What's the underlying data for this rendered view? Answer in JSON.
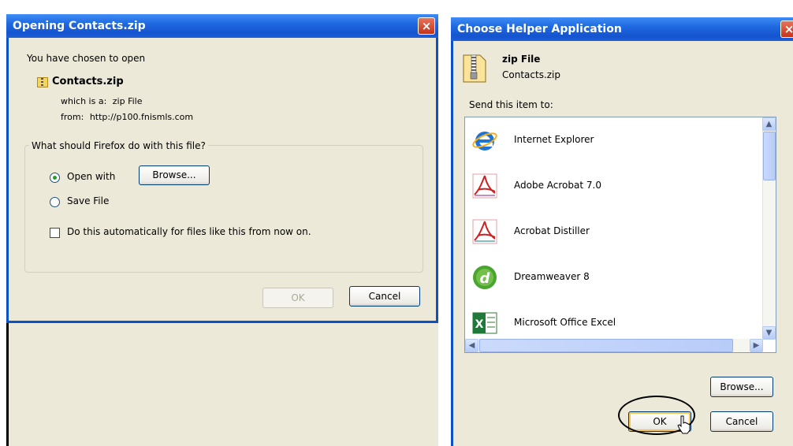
{
  "left_dialog": {
    "title": "Opening Contacts.zip",
    "close_glyph": "×",
    "intro": "You have chosen to open",
    "file_name": "Contacts.zip",
    "which_is_label": "which is a:",
    "which_is_value": "zip File",
    "from_label": "from:",
    "from_value": "http://p100.fnismls.com",
    "group_label": "What should Firefox do with this file?",
    "open_with_label": "Open with",
    "open_with_selected": true,
    "browse_label": "Browse...",
    "save_file_label": "Save File",
    "save_file_selected": false,
    "auto_label": "Do this automatically for files like this from now on.",
    "auto_checked": false,
    "ok_label": "OK",
    "cancel_label": "Cancel"
  },
  "right_dialog": {
    "title": "Choose Helper Application",
    "close_glyph": "×",
    "file_type": "zip File",
    "file_name": "Contacts.zip",
    "send_to_label": "Send this item to:",
    "apps": [
      {
        "label": "Internet Explorer",
        "icon": "internet-explorer-icon"
      },
      {
        "label": "Adobe Acrobat 7.0",
        "icon": "adobe-acrobat-icon"
      },
      {
        "label": "Acrobat  Distiller",
        "icon": "acrobat-distiller-icon"
      },
      {
        "label": "Dreamweaver 8",
        "icon": "dreamweaver-icon"
      },
      {
        "label": "Microsoft Office Excel",
        "icon": "excel-icon"
      }
    ],
    "scroll_up_glyph": "▲",
    "scroll_down_glyph": "▼",
    "scroll_left_glyph": "◀",
    "scroll_right_glyph": "▶",
    "browse_label": "Browse...",
    "ok_label": "OK",
    "cancel_label": "Cancel"
  },
  "colors": {
    "title_bar": "#1f68e0",
    "dialog_bg": "#ece9d8",
    "button_border": "#003c74"
  }
}
